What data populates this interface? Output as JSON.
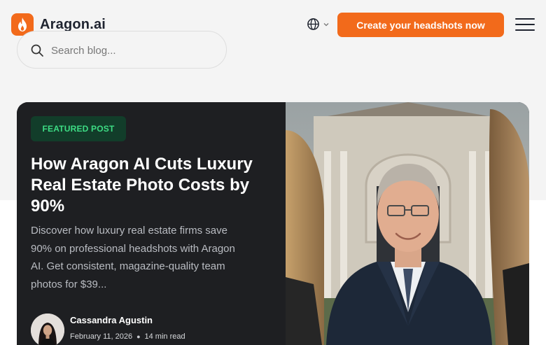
{
  "brand": {
    "name": "Aragon.ai",
    "accent": "#f26a1b"
  },
  "header": {
    "language_icon": "globe-icon",
    "cta_label": "Create your headshots now",
    "menu_icon": "hamburger-icon"
  },
  "search": {
    "placeholder": "Search blog..."
  },
  "featured": {
    "badge": "FEATURED POST",
    "badge_color": "#3ddc84",
    "title": "How Aragon AI Cuts Luxury Real Estate Photo Costs by 90%",
    "excerpt": "Discover how luxury real estate firms save 90% on professional headshots with Aragon AI. Get consistent, magazine-quality team photos for $39...",
    "author": {
      "name": "Cassandra Agustin",
      "date": "February 11, 2026",
      "read_time": "14 min read"
    }
  }
}
